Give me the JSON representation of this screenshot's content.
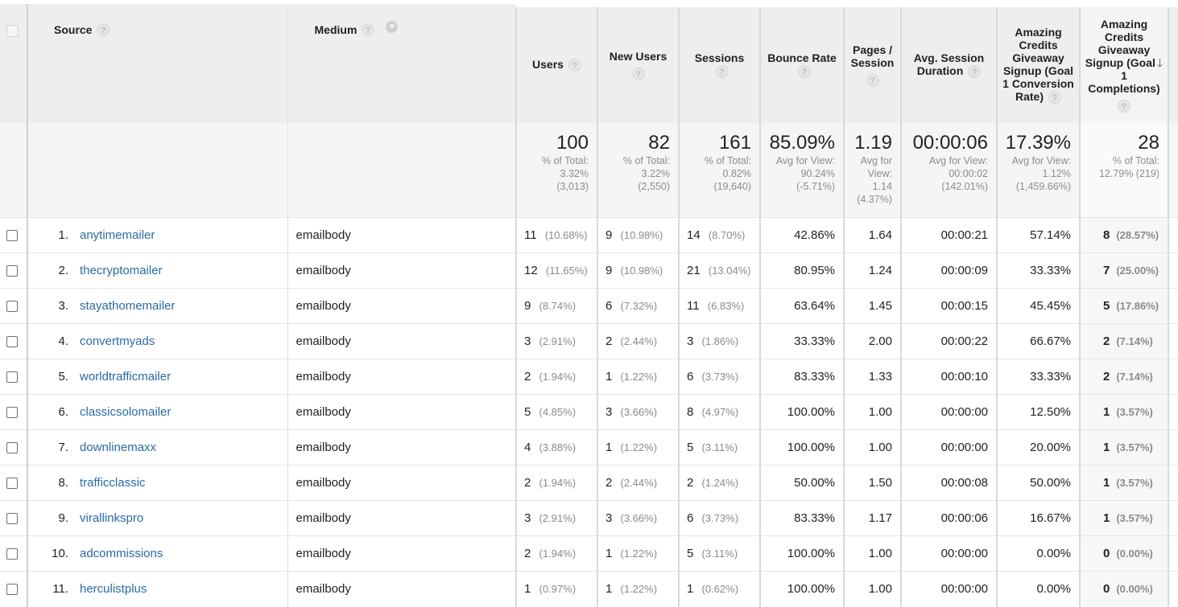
{
  "header": {
    "source_label": "Source",
    "medium_label": "Medium",
    "help_glyph": "?",
    "remove_glyph": "×",
    "sort_glyph": "🡓",
    "metrics": [
      [
        "Users"
      ],
      [
        "New Users"
      ],
      [
        "Sessions"
      ],
      [
        "Bounce Rate"
      ],
      [
        "Pages /",
        "Session"
      ],
      [
        "Avg. Session",
        "Duration"
      ],
      [
        "Amazing",
        "Credits",
        "Giveaway",
        "Signup (Goal",
        "1 Conversion",
        "Rate)"
      ],
      [
        "Amazing",
        "Credits",
        "Giveaway",
        "Signup (Goal",
        "1",
        "Completions)"
      ]
    ]
  },
  "totals": [
    {
      "value": "100",
      "sub": [
        "% of Total:",
        "3.32%",
        "(3,013)"
      ]
    },
    {
      "value": "82",
      "sub": [
        "% of Total:",
        "3.22%",
        "(2,550)"
      ]
    },
    {
      "value": "161",
      "sub": [
        "% of Total:",
        "0.82%",
        "(19,640)"
      ]
    },
    {
      "value": "85.09%",
      "sub": [
        "Avg for View:",
        "90.24%",
        "(-5.71%)"
      ]
    },
    {
      "value": "1.19",
      "sub": [
        "Avg for",
        "View:",
        "1.14",
        "(4.37%)"
      ]
    },
    {
      "value": "00:00:06",
      "sub": [
        "Avg for View:",
        "00:00:02",
        "(142.01%)"
      ]
    },
    {
      "value": "17.39%",
      "sub": [
        "Avg for View:",
        "1.12%",
        "(1,459.66%)"
      ]
    },
    {
      "value": "28",
      "sub": [
        "% of Total:",
        "12.79% (219)"
      ]
    }
  ],
  "rows": [
    {
      "rank": "1.",
      "source": "anytimemailer",
      "medium": "emailbody",
      "users": "11",
      "users_pct": "(10.68%)",
      "new_users": "9",
      "new_users_pct": "(10.98%)",
      "sessions": "14",
      "sessions_pct": "(8.70%)",
      "bounce_rate": "42.86%",
      "pages_session": "1.64",
      "duration": "00:00:21",
      "conv_rate": "57.14%",
      "completions": "8",
      "completions_pct": "(28.57%)"
    },
    {
      "rank": "2.",
      "source": "thecryptomailer",
      "medium": "emailbody",
      "users": "12",
      "users_pct": "(11.65%)",
      "new_users": "9",
      "new_users_pct": "(10.98%)",
      "sessions": "21",
      "sessions_pct": "(13.04%)",
      "bounce_rate": "80.95%",
      "pages_session": "1.24",
      "duration": "00:00:09",
      "conv_rate": "33.33%",
      "completions": "7",
      "completions_pct": "(25.00%)"
    },
    {
      "rank": "3.",
      "source": "stayathomemailer",
      "medium": "emailbody",
      "users": "9",
      "users_pct": "(8.74%)",
      "new_users": "6",
      "new_users_pct": "(7.32%)",
      "sessions": "11",
      "sessions_pct": "(6.83%)",
      "bounce_rate": "63.64%",
      "pages_session": "1.45",
      "duration": "00:00:15",
      "conv_rate": "45.45%",
      "completions": "5",
      "completions_pct": "(17.86%)"
    },
    {
      "rank": "4.",
      "source": "convertmyads",
      "medium": "emailbody",
      "users": "3",
      "users_pct": "(2.91%)",
      "new_users": "2",
      "new_users_pct": "(2.44%)",
      "sessions": "3",
      "sessions_pct": "(1.86%)",
      "bounce_rate": "33.33%",
      "pages_session": "2.00",
      "duration": "00:00:22",
      "conv_rate": "66.67%",
      "completions": "2",
      "completions_pct": "(7.14%)"
    },
    {
      "rank": "5.",
      "source": "worldtrafficmailer",
      "medium": "emailbody",
      "users": "2",
      "users_pct": "(1.94%)",
      "new_users": "1",
      "new_users_pct": "(1.22%)",
      "sessions": "6",
      "sessions_pct": "(3.73%)",
      "bounce_rate": "83.33%",
      "pages_session": "1.33",
      "duration": "00:00:10",
      "conv_rate": "33.33%",
      "completions": "2",
      "completions_pct": "(7.14%)"
    },
    {
      "rank": "6.",
      "source": "classicsolomailer",
      "medium": "emailbody",
      "users": "5",
      "users_pct": "(4.85%)",
      "new_users": "3",
      "new_users_pct": "(3.66%)",
      "sessions": "8",
      "sessions_pct": "(4.97%)",
      "bounce_rate": "100.00%",
      "pages_session": "1.00",
      "duration": "00:00:00",
      "conv_rate": "12.50%",
      "completions": "1",
      "completions_pct": "(3.57%)"
    },
    {
      "rank": "7.",
      "source": "downlinemaxx",
      "medium": "emailbody",
      "users": "4",
      "users_pct": "(3.88%)",
      "new_users": "1",
      "new_users_pct": "(1.22%)",
      "sessions": "5",
      "sessions_pct": "(3.11%)",
      "bounce_rate": "100.00%",
      "pages_session": "1.00",
      "duration": "00:00:00",
      "conv_rate": "20.00%",
      "completions": "1",
      "completions_pct": "(3.57%)"
    },
    {
      "rank": "8.",
      "source": "trafficclassic",
      "medium": "emailbody",
      "users": "2",
      "users_pct": "(1.94%)",
      "new_users": "2",
      "new_users_pct": "(2.44%)",
      "sessions": "2",
      "sessions_pct": "(1.24%)",
      "bounce_rate": "50.00%",
      "pages_session": "1.50",
      "duration": "00:00:08",
      "conv_rate": "50.00%",
      "completions": "1",
      "completions_pct": "(3.57%)"
    },
    {
      "rank": "9.",
      "source": "virallinkspro",
      "medium": "emailbody",
      "users": "3",
      "users_pct": "(2.91%)",
      "new_users": "3",
      "new_users_pct": "(3.66%)",
      "sessions": "6",
      "sessions_pct": "(3.73%)",
      "bounce_rate": "83.33%",
      "pages_session": "1.17",
      "duration": "00:00:06",
      "conv_rate": "16.67%",
      "completions": "1",
      "completions_pct": "(3.57%)"
    },
    {
      "rank": "10.",
      "source": "adcommissions",
      "medium": "emailbody",
      "users": "2",
      "users_pct": "(1.94%)",
      "new_users": "1",
      "new_users_pct": "(1.22%)",
      "sessions": "5",
      "sessions_pct": "(3.11%)",
      "bounce_rate": "100.00%",
      "pages_session": "1.00",
      "duration": "00:00:00",
      "conv_rate": "0.00%",
      "completions": "0",
      "completions_pct": "(0.00%)"
    },
    {
      "rank": "11.",
      "source": "herculistplus",
      "medium": "emailbody",
      "users": "1",
      "users_pct": "(0.97%)",
      "new_users": "1",
      "new_users_pct": "(1.22%)",
      "sessions": "1",
      "sessions_pct": "(0.62%)",
      "bounce_rate": "100.00%",
      "pages_session": "1.00",
      "duration": "00:00:00",
      "conv_rate": "0.00%",
      "completions": "0",
      "completions_pct": "(0.00%)"
    }
  ],
  "colors": {
    "link": "#2b6aa6",
    "header_bg": "#eeeeee",
    "totals_bg": "#f5f5f5",
    "muted": "#8a8a8a"
  },
  "icons": {
    "help": "help-circle-icon",
    "remove": "close-circle-icon",
    "sort": "arrow-down-icon",
    "checkbox": "checkbox"
  }
}
